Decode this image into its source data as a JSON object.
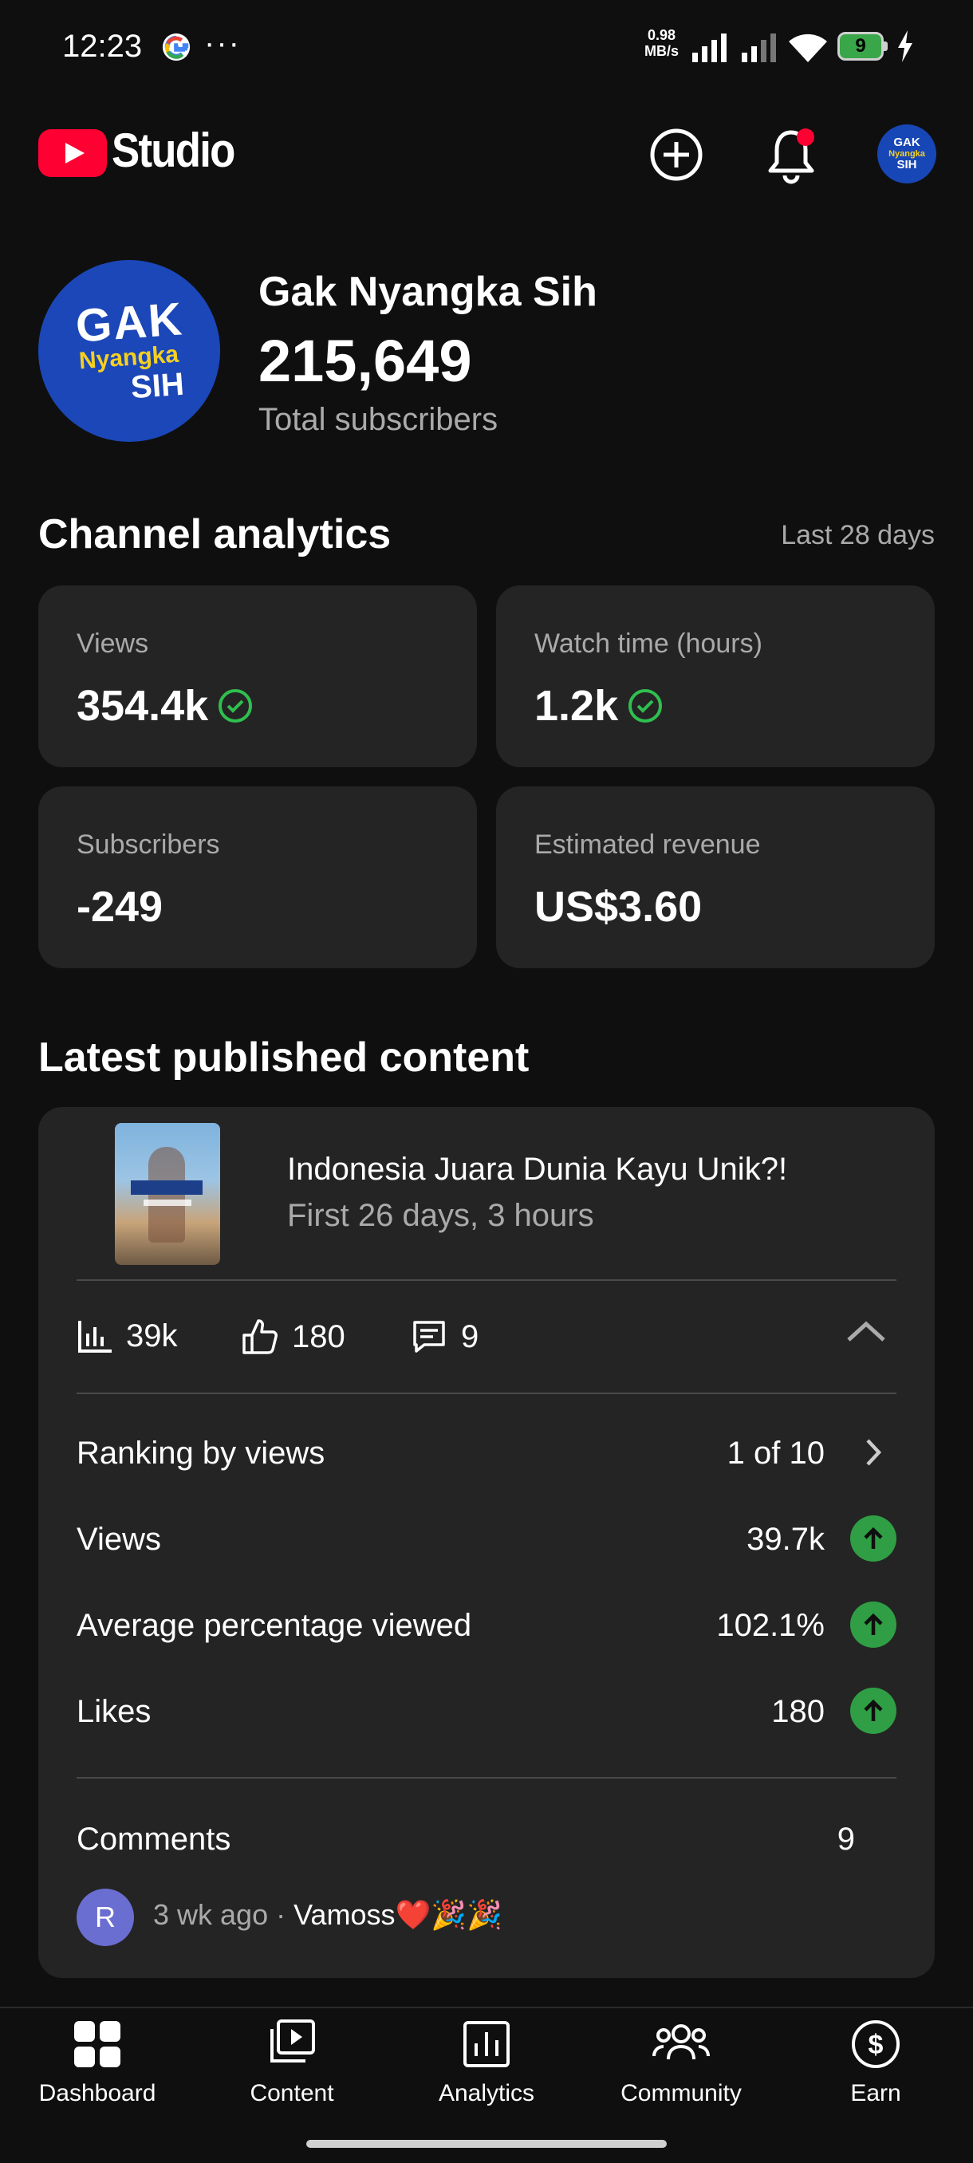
{
  "status_bar": {
    "time": "12:23",
    "more": "···",
    "net_speed_value": "0.98",
    "net_speed_unit": "MB/s",
    "battery": "9"
  },
  "header": {
    "app_name": "Studio",
    "channel_avatar_text": [
      "GAK",
      "Nyangka",
      "SIH"
    ]
  },
  "channel": {
    "name": "Gak Nyangka Sih",
    "subscribers": "215,649",
    "subscribers_label": "Total subscribers",
    "avatar_text": [
      "GAK",
      "Nyangka",
      "SIH"
    ]
  },
  "analytics": {
    "title": "Channel analytics",
    "period": "Last 28 days",
    "stats": [
      {
        "label": "Views",
        "value": "354.4k",
        "check": true
      },
      {
        "label": "Watch time (hours)",
        "value": "1.2k",
        "check": true
      },
      {
        "label": "Subscribers",
        "value": "-249",
        "check": false
      },
      {
        "label": "Estimated revenue",
        "value": "US$3.60",
        "check": false
      }
    ],
    "check_color": "#2fbf4f"
  },
  "latest": {
    "title": "Latest published content",
    "video": {
      "title": "Indonesia Juara Dunia Kayu Unik?!",
      "subtitle": "First 26 days, 3 hours"
    },
    "mini_stats": {
      "views": "39k",
      "likes": "180",
      "comments": "9"
    },
    "rows": [
      {
        "label": "Ranking by views",
        "value": "1 of 10",
        "icon": "chevron-right-icon"
      },
      {
        "label": "Views",
        "value": "39.7k",
        "icon": "arrow-up-icon"
      },
      {
        "label": "Average percentage viewed",
        "value": "102.1%",
        "icon": "arrow-up-icon"
      },
      {
        "label": "Likes",
        "value": "180",
        "icon": "arrow-up-icon"
      }
    ],
    "comments_row": {
      "label": "Comments",
      "value": "9"
    },
    "comment": {
      "avatar_letter": "R",
      "age": "3 wk ago · ",
      "text": "Vamoss❤️🎉🎉"
    },
    "up_color": "#2f9e44"
  },
  "bottom_nav": {
    "items": [
      "Dashboard",
      "Content",
      "Analytics",
      "Community",
      "Earn"
    ]
  }
}
